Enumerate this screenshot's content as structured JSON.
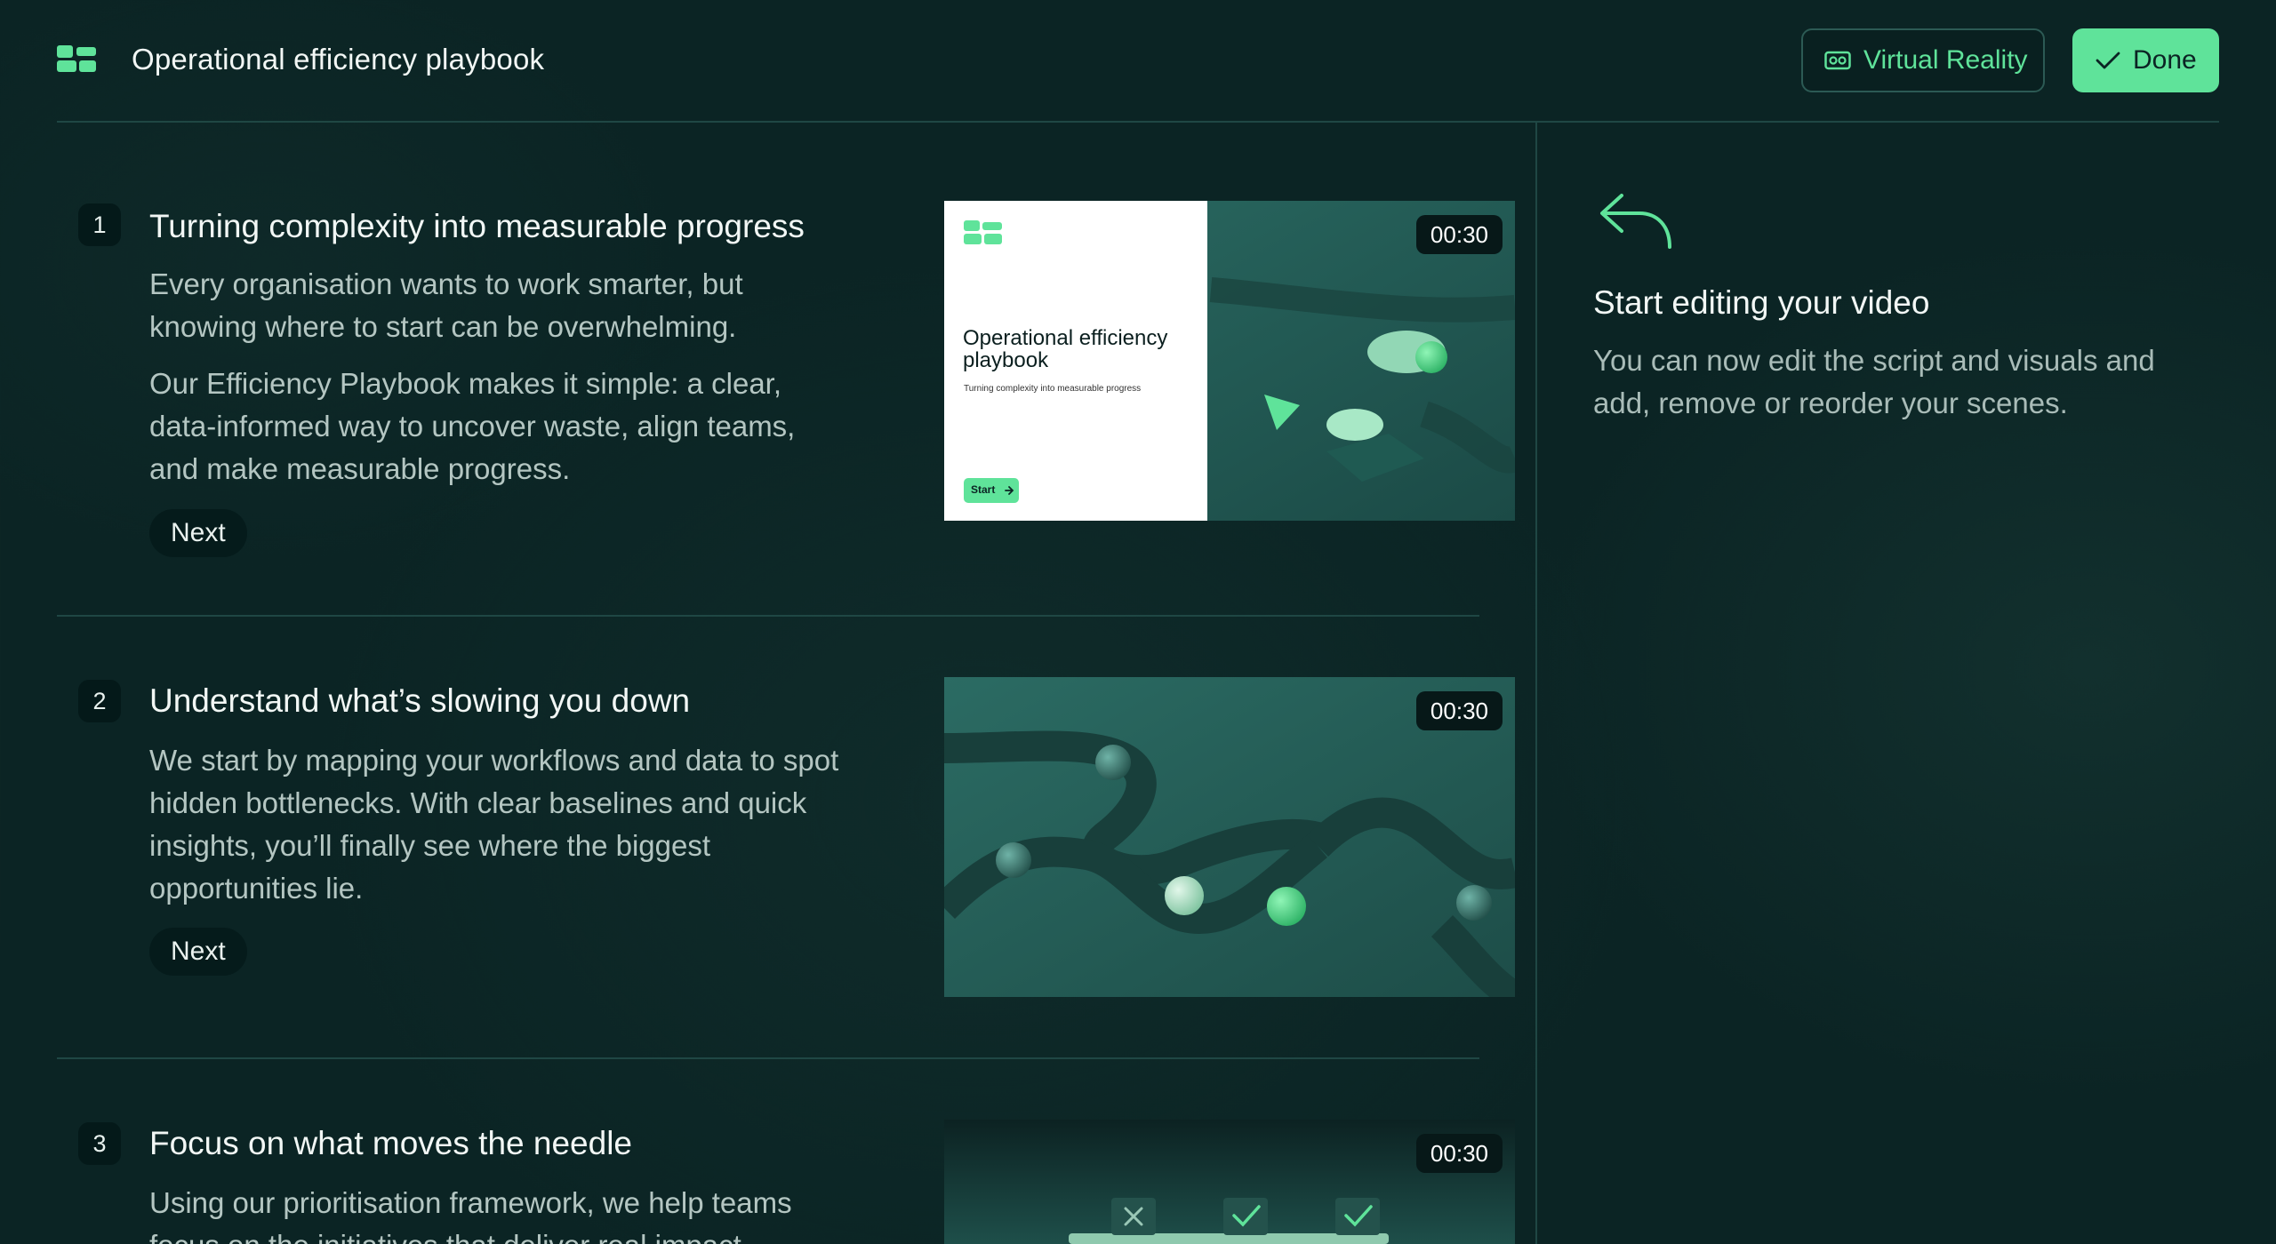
{
  "header": {
    "title": "Operational efficiency playbook",
    "vr_button": "Virtual Reality",
    "done_button": "Done"
  },
  "hint": {
    "title": "Start editing your video",
    "text": "You can now edit the script and visuals and add, remove or reorder your scenes."
  },
  "scenes": [
    {
      "number": "1",
      "title": "Turning complexity into measurable progress",
      "paragraphs": [
        "Every organisation wants to work smarter, but knowing where to start can be overwhelming.",
        "Our Efficiency Playbook makes it simple: a clear, data-informed way to uncover waste, align teams, and make measurable progress."
      ],
      "next_label": "Next",
      "duration": "00:30",
      "card": {
        "title": "Operational efficiency playbook",
        "subtitle": "Turning complexity into measurable progress",
        "start_label": "Start"
      }
    },
    {
      "number": "2",
      "title": "Understand what’s slowing you down",
      "paragraphs": [
        "We start by mapping your workflows and data to spot hidden bottlenecks. With clear baselines and quick insights, you’ll finally see where the biggest opportunities lie."
      ],
      "next_label": "Next",
      "duration": "00:30"
    },
    {
      "number": "3",
      "title": "Focus on what moves the needle",
      "paragraphs": [
        "Using our prioritisation framework, we help teams focus on the initiatives that deliver real impact."
      ],
      "duration": "00:30"
    }
  ],
  "colors": {
    "accent": "#5fe39a",
    "background": "#0b2424",
    "divider": "#1f4744"
  },
  "icons": {
    "logo": "grid-logo-icon",
    "vr": "vr-headset-icon",
    "done": "check-icon",
    "hint": "reply-arrow-icon"
  }
}
